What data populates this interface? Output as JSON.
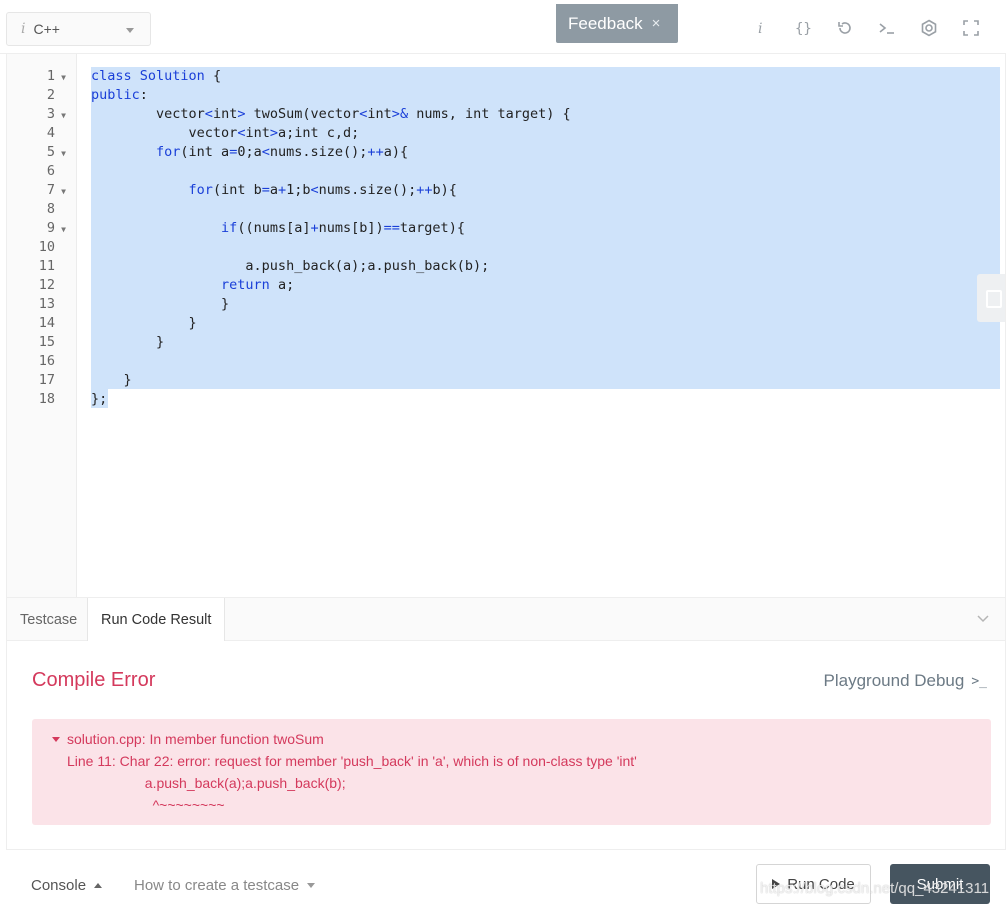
{
  "toolbar": {
    "language": "C++",
    "language_icon": "i",
    "feedback_label": "Feedback",
    "feedback_close": "×",
    "icons": [
      "info-icon",
      "braces-icon",
      "reset-icon",
      "console-icon",
      "settings-icon",
      "fullscreen-icon"
    ]
  },
  "editor": {
    "lines": [
      {
        "num": "1",
        "fold": true,
        "text": "class Solution {"
      },
      {
        "num": "2",
        "fold": false,
        "text": "public:"
      },
      {
        "num": "3",
        "fold": true,
        "text": "        vector<int> twoSum(vector<int>& nums, int target) {"
      },
      {
        "num": "4",
        "fold": false,
        "text": "            vector<int>a;int c,d;"
      },
      {
        "num": "5",
        "fold": true,
        "text": "        for(int a=0;a<nums.size();++a){"
      },
      {
        "num": "6",
        "fold": false,
        "text": ""
      },
      {
        "num": "7",
        "fold": true,
        "text": "            for(int b=a+1;b<nums.size();++b){"
      },
      {
        "num": "8",
        "fold": false,
        "text": ""
      },
      {
        "num": "9",
        "fold": true,
        "text": "                if((nums[a]+nums[b])==target){"
      },
      {
        "num": "10",
        "fold": false,
        "text": ""
      },
      {
        "num": "11",
        "fold": false,
        "text": "                   a.push_back(a);a.push_back(b);"
      },
      {
        "num": "12",
        "fold": false,
        "text": "                return a;"
      },
      {
        "num": "13",
        "fold": false,
        "text": "                }"
      },
      {
        "num": "14",
        "fold": false,
        "text": "            }"
      },
      {
        "num": "15",
        "fold": false,
        "text": "        }"
      },
      {
        "num": "16",
        "fold": false,
        "text": ""
      },
      {
        "num": "17",
        "fold": false,
        "text": "    }"
      },
      {
        "num": "18",
        "fold": false,
        "text": "};"
      }
    ]
  },
  "tabs": {
    "testcase": "Testcase",
    "run_code_result": "Run Code Result"
  },
  "result": {
    "title": "Compile Error",
    "playground_debug": "Playground Debug",
    "playground_icon": ">_",
    "error_lines": [
      "solution.cpp: In member function twoSum",
      "Line 11: Char 22: error: request for member 'push_back' in 'a', which is of non-class type 'int'",
      "                    a.push_back(a);a.push_back(b);",
      "                      ^~~~~~~~~"
    ]
  },
  "footer": {
    "console": "Console",
    "how_to": "How to create a testcase",
    "run_code": "Run Code",
    "submit": "Submit",
    "watermark": "https://blog.csdn.net/qq_43241311"
  }
}
